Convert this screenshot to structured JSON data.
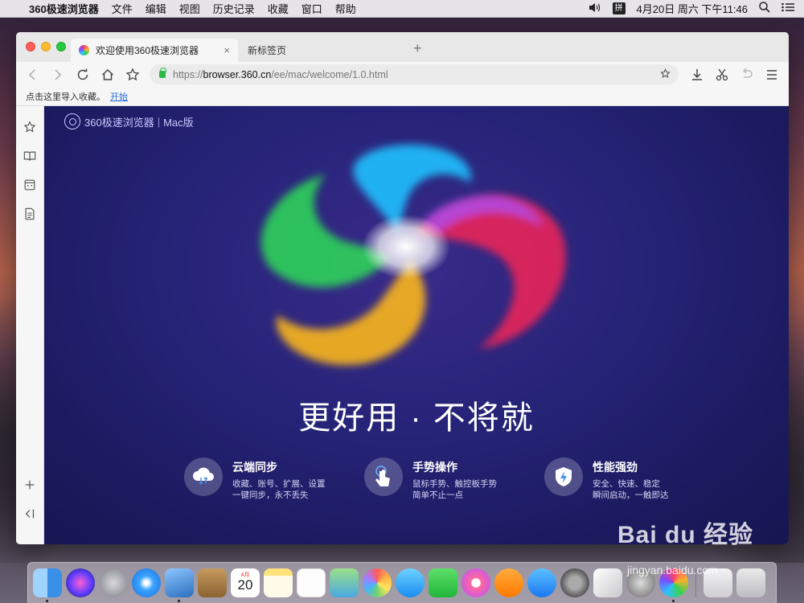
{
  "menubar": {
    "app_name": "360极速浏览器",
    "items": [
      "文件",
      "编辑",
      "视图",
      "历史记录",
      "收藏",
      "窗口",
      "帮助"
    ],
    "ime_label": "拼",
    "clock": "4月20日 周六 下午11:46"
  },
  "tabs": [
    {
      "label": "欢迎使用360极速浏览器",
      "active": true
    },
    {
      "label": "新标签页",
      "active": false
    }
  ],
  "new_tab_symbol": "+",
  "close_symbol": "×",
  "address": {
    "scheme": "https://",
    "host": "browser.360.cn",
    "path": "/ee/mac/welcome/1.0.html"
  },
  "bookmarks_bar": {
    "text": "点击这里导入收藏。",
    "link": "开始"
  },
  "page": {
    "brand_name": "360极速浏览器",
    "brand_sep": "|",
    "brand_edition": "Mac版",
    "slogan": "更好用 · 不将就",
    "features": [
      {
        "title": "云端同步",
        "line1": "收藏、账号、扩展、设置",
        "line2": "一键同步，永不丢失",
        "icon": "cloud-sync-icon"
      },
      {
        "title": "手势操作",
        "line1": "鼠标手势、触控板手势",
        "line2": "简单不止一点",
        "icon": "gesture-icon"
      },
      {
        "title": "性能强劲",
        "line1": "安全、快速、稳定",
        "line2": "瞬间启动，一触即达",
        "icon": "shield-bolt-icon"
      }
    ]
  },
  "dock": {
    "calendar_month": "4月",
    "calendar_day": "20"
  },
  "watermark": {
    "text": "Bai du 经验",
    "url": "jingyan.baidu.com"
  },
  "colors": {
    "content_bg": "#1b1a5e",
    "accent_green": "#2fb84a",
    "link_blue": "#2a6ed8"
  }
}
